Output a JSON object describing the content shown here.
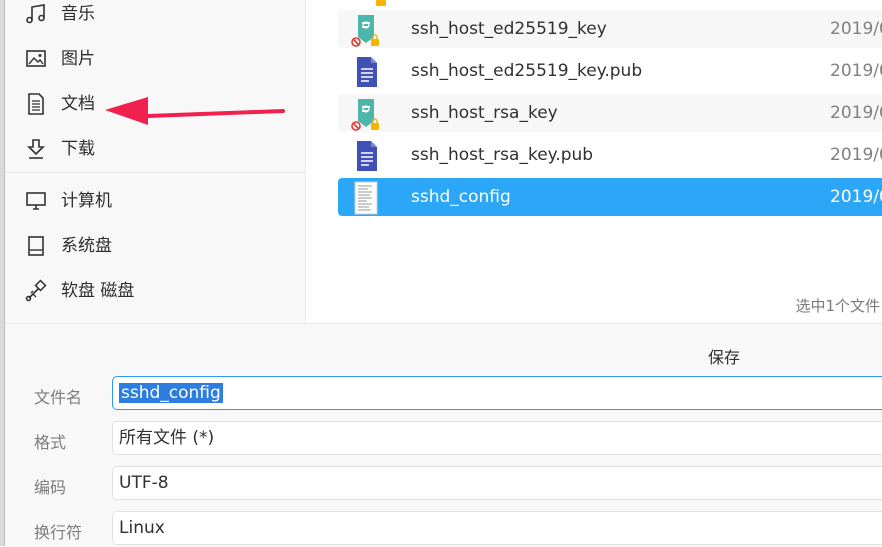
{
  "sidebar": {
    "items": [
      {
        "label": "音乐",
        "icon": "music-note-icon"
      },
      {
        "label": "图片",
        "icon": "picture-icon"
      },
      {
        "label": "文档",
        "icon": "document-icon"
      },
      {
        "label": "下载",
        "icon": "download-icon"
      },
      {
        "label": "计算机",
        "icon": "computer-icon"
      },
      {
        "label": "系统盘",
        "icon": "disk-icon"
      },
      {
        "label": "软盘 磁盘",
        "icon": "usb-disk-icon"
      }
    ]
  },
  "files": [
    {
      "name": "ssh_host_ed25519_key",
      "date": "2019/0",
      "icon": "locked-key-file-icon"
    },
    {
      "name": "ssh_host_ed25519_key.pub",
      "date": "2019/0",
      "icon": "text-document-icon"
    },
    {
      "name": "ssh_host_rsa_key",
      "date": "2019/0",
      "icon": "locked-key-file-icon"
    },
    {
      "name": "ssh_host_rsa_key.pub",
      "date": "2019/0",
      "icon": "text-document-icon"
    },
    {
      "name": "sshd_config",
      "date": "2019/0",
      "icon": "config-file-icon"
    }
  ],
  "status": "选中1个文件",
  "save_panel": {
    "title": "保存",
    "filename_label": "文件名",
    "filename_value": "sshd_config",
    "format_label": "格式",
    "format_value": "所有文件 (*)",
    "encoding_label": "编码",
    "encoding_value": "UTF-8",
    "lineend_label": "换行符",
    "lineend_value": "Linux"
  },
  "colors": {
    "selection": "#2ca7f8",
    "arrow": "#f0214f",
    "focus_border": "#2c9af0"
  }
}
